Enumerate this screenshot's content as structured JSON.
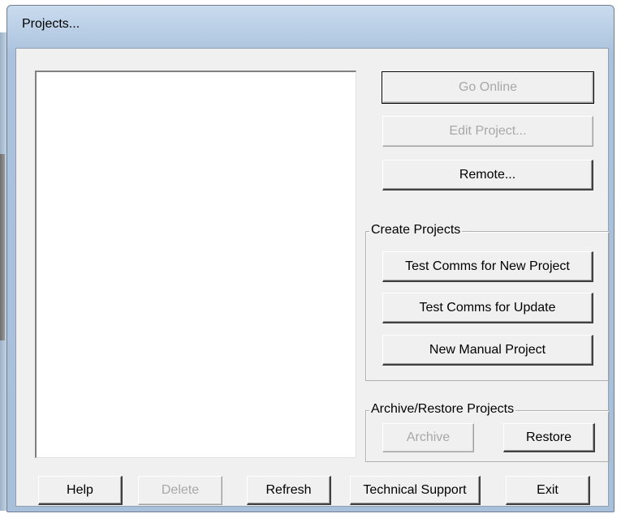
{
  "window": {
    "title": "Projects..."
  },
  "project_list": {
    "items": []
  },
  "right_buttons": {
    "go_online": "Go Online",
    "edit_project": "Edit Project...",
    "remote": "Remote..."
  },
  "create_projects": {
    "label": "Create Projects",
    "test_comms_new": "Test Comms for New Project",
    "test_comms_update": "Test Comms for Update",
    "new_manual": "New Manual Project"
  },
  "archive_restore": {
    "label": "Archive/Restore Projects",
    "archive": "Archive",
    "restore": "Restore"
  },
  "bottom_buttons": {
    "help": "Help",
    "delete": "Delete",
    "refresh": "Refresh",
    "technical_support": "Technical Support",
    "exit": "Exit"
  },
  "colors": {
    "title_bar": "#b5cbe3",
    "dialog_face": "#f0f0f0",
    "disabled_text": "#a8a8a8"
  }
}
